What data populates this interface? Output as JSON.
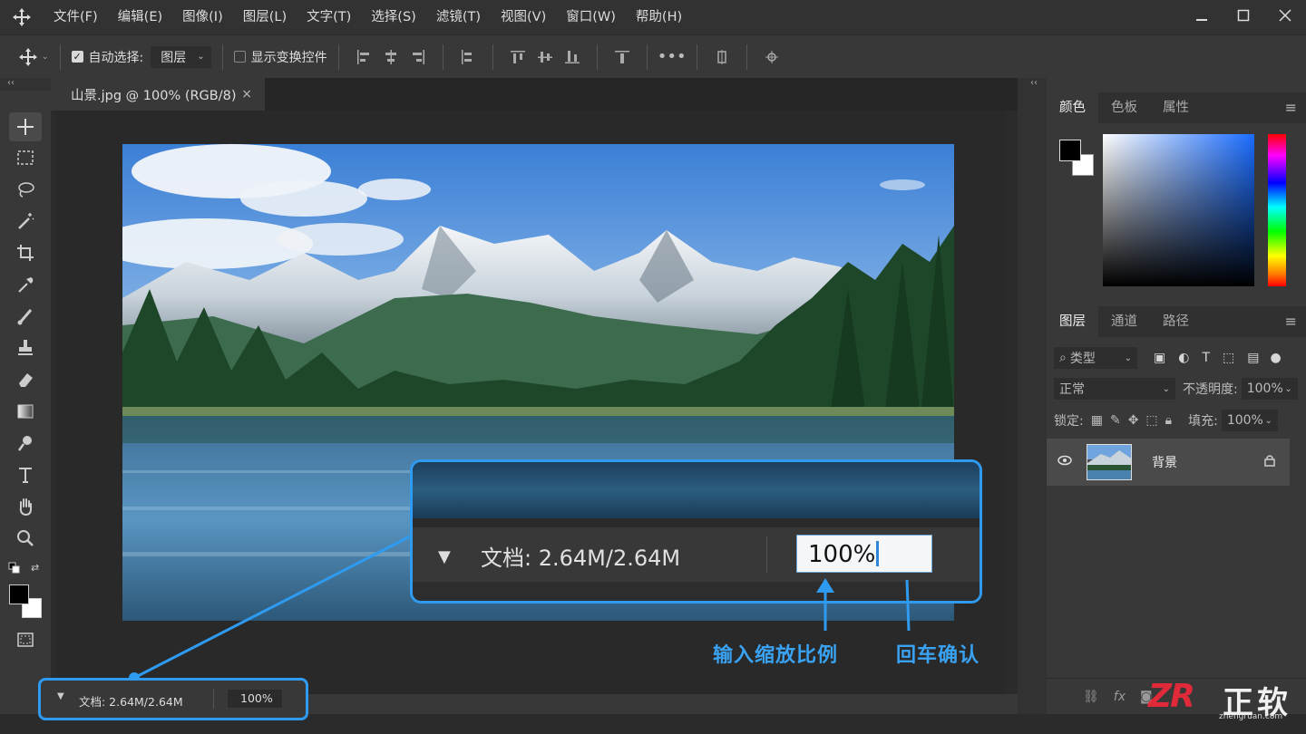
{
  "menubar": {
    "items": [
      "文件(F)",
      "编辑(E)",
      "图像(I)",
      "图层(L)",
      "文字(T)",
      "选择(S)",
      "滤镜(T)",
      "视图(V)",
      "窗口(W)",
      "帮助(H)"
    ],
    "window_controls": [
      "minimize-icon",
      "restore-icon",
      "close-icon"
    ]
  },
  "options": {
    "auto_select_label": "自动选择:",
    "auto_select_checked": true,
    "auto_select_target": "图层",
    "show_transform_label": "显示变换控件",
    "show_transform_checked": false
  },
  "document_tab": {
    "title": "山景.jpg @ 100% (RGB/8)",
    "close": "×"
  },
  "panels": {
    "color_tabs": [
      "颜色",
      "色板",
      "属性"
    ],
    "layer_tabs": [
      "图层",
      "通道",
      "路径"
    ],
    "filter_kind": "类型",
    "blend_mode": "正常",
    "opacity_label": "不透明度:",
    "opacity_value": "100%",
    "lock_label": "锁定:",
    "fill_label": "填充:",
    "fill_value": "100%",
    "layer_name": "背景"
  },
  "status": {
    "doc_size": "文档: 2.64M/2.64M",
    "zoom": "100%"
  },
  "callout": {
    "doc_size": "文档: 2.64M/2.64M",
    "zoom": "100%",
    "label_input": "输入缩放比例",
    "label_enter": "回车确认"
  },
  "watermark": {
    "logo": "ZR",
    "text": "正软",
    "url": "zhengruan.com"
  },
  "colors": {
    "accent": "#2f9bf0",
    "panel": "#383838",
    "background": "#2b2b2b"
  }
}
